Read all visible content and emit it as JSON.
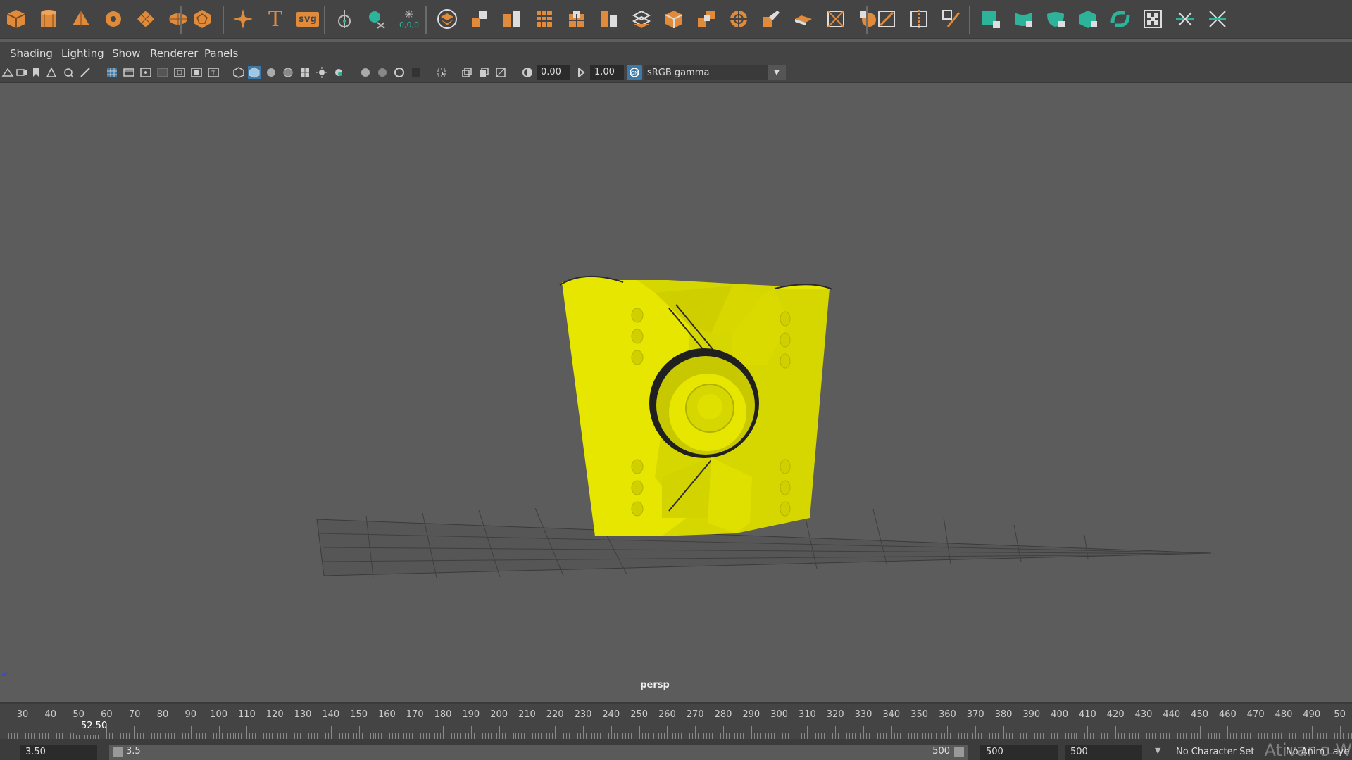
{
  "shelf": {
    "icons_group1": [
      "poly-cube-icon",
      "poly-cylinder-icon",
      "poly-cone-icon",
      "poly-torus-icon",
      "poly-plane-icon",
      "poly-disc-icon"
    ],
    "icons_group2": [
      "platonic-solid-icon"
    ],
    "icons_group3": [
      "sparkle-icon",
      "text-icon",
      "svg-icon"
    ],
    "svg_label": "svg",
    "text_label": "T",
    "icons_group4": [
      "pivot-icon",
      "snap-icon",
      "freeze-transform-icon"
    ],
    "freeze_label": "0,0,0",
    "icons_group5": [
      "combine-icon",
      "separate-icon",
      "extract-icon",
      "smooth-icon",
      "boolean-icon",
      "mirror-icon",
      "fill-hole-icon",
      "reduce-icon",
      "extrude-icon",
      "bridge-icon",
      "bevel-icon",
      "wedge-icon",
      "poke-icon",
      "bounding-box-icon",
      "sculpt-icon"
    ],
    "icons_group6": [
      "multi-cut-icon",
      "edge-loop-icon",
      "target-weld-icon"
    ],
    "icons_group7": [
      "uv-planar-icon",
      "uv-cylindrical-icon",
      "uv-spherical-icon",
      "uv-auto-icon",
      "uv-unfold-icon",
      "uv-checker-icon",
      "uv-cut-icon",
      "uv-sew-icon"
    ],
    "accent_orange": "#e08a3c",
    "accent_green": "#2db39a"
  },
  "menubar": {
    "items": [
      "Shading",
      "Lighting",
      "Show",
      "Renderer",
      "Panels"
    ]
  },
  "viewport_toolbar": {
    "exposure": "0.00",
    "gamma": "1.00",
    "color_space": "sRGB gamma"
  },
  "viewport": {
    "camera_label": "persp",
    "model_color": "#e6e600"
  },
  "timeline": {
    "ticks": [
      "30",
      "40",
      "50",
      "60",
      "70",
      "80",
      "90",
      "100",
      "110",
      "120",
      "130",
      "140",
      "150",
      "160",
      "170",
      "180",
      "190",
      "200",
      "210",
      "220",
      "230",
      "240",
      "250",
      "260",
      "270",
      "280",
      "290",
      "300",
      "310",
      "320",
      "330",
      "340",
      "350",
      "360",
      "370",
      "380",
      "390",
      "400",
      "410",
      "420",
      "430",
      "440",
      "450",
      "460",
      "470",
      "480",
      "490",
      "50"
    ],
    "current_frame": "52.50"
  },
  "range_slider": {
    "start": "3.50",
    "slider_start": "3.5",
    "slider_end": "500",
    "end1": "500",
    "end2": "500",
    "character_set": "No Character Set",
    "anim_layer": "No Anim Laye",
    "watermark": "Ativar o W"
  }
}
